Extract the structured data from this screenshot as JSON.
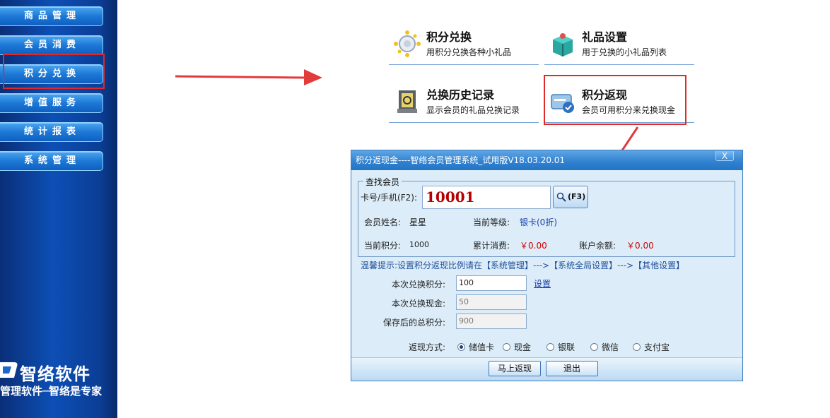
{
  "sidebar": {
    "items": [
      {
        "label": "商品管理"
      },
      {
        "label": "会员消费"
      },
      {
        "label": "积分兑换"
      },
      {
        "label": "增值服务"
      },
      {
        "label": "统计报表"
      },
      {
        "label": "系统管理"
      }
    ],
    "brand_name": "智络软件",
    "brand_tagline": "管理软件─智络是专家",
    "colors": {
      "highlight": "#e02a2a",
      "sidebar_bg": "#0d4fb5"
    }
  },
  "tiles": [
    {
      "title": "积分兑换",
      "desc": "用积分兑换各种小礼品",
      "icon": "points-exchange-icon"
    },
    {
      "title": "礼品设置",
      "desc": "用于兑换的小礼品列表",
      "icon": "gift-box-icon"
    },
    {
      "title": "兑换历史记录",
      "desc": "显示会员的礼品兑换记录",
      "icon": "history-record-icon"
    },
    {
      "title": "积分返现",
      "desc": "会员可用积分来兑换现金",
      "icon": "cashback-card-icon"
    }
  ],
  "dialog": {
    "title": "积分返现金----智络会员管理系统_试用版V18.03.20.01",
    "close_label": "X",
    "search_group": {
      "legend": "查找会员",
      "card_label": "卡号/手机(F2):",
      "card_value": "10001",
      "search_button": "(F3)"
    },
    "member": {
      "name_label": "会员姓名:",
      "name_value": "星星",
      "level_label": "当前等级:",
      "level_value": "银卡(0折)",
      "points_label": "当前积分:",
      "points_value": "1000",
      "spend_label": "累计消费:",
      "spend_value": "￥0.00",
      "balance_label": "账户余额:",
      "balance_value": "￥0.00"
    },
    "hint": "温馨提示:设置积分返现比例请在【系统管理】--->【系统全局设置】--->【其他设置】",
    "form": {
      "exchange_points_label": "本次兑换积分:",
      "exchange_points_value": "100",
      "set_link": "设置",
      "exchange_cash_label": "本次兑换现金:",
      "exchange_cash_value": "50",
      "total_points_label": "保存后的总积分:",
      "total_points_value": "900",
      "method_label": "返现方式:",
      "methods": [
        "储值卡",
        "现金",
        "银联",
        "微信",
        "支付宝"
      ],
      "selected_method": "储值卡"
    },
    "buttons": {
      "confirm": "马上返现",
      "exit": "退出"
    }
  }
}
